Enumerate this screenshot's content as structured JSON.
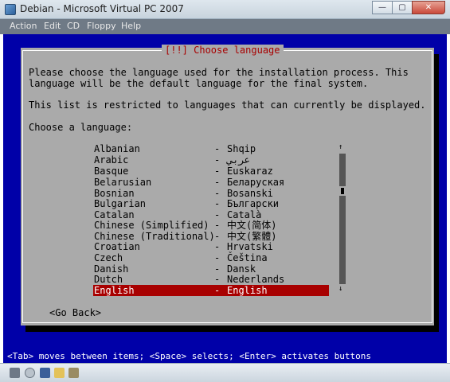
{
  "window": {
    "title": "Debian - Microsoft Virtual PC 2007",
    "min_glyph": "—",
    "restore_glyph": "▢",
    "close_glyph": "✕"
  },
  "menu": {
    "items": [
      "Action",
      "Edit",
      "CD",
      "Floppy",
      "Help"
    ]
  },
  "dialog": {
    "title": "[!!] Choose language",
    "intro_line1": "Please choose the language used for the installation process. This",
    "intro_line2": "language will be the default language for the final system.",
    "restriction": "This list is restricted to languages that can currently be displayed.",
    "prompt": "Choose a language:",
    "languages": [
      {
        "name": "Albanian",
        "native": "Shqip"
      },
      {
        "name": "Arabic",
        "native": "عربي"
      },
      {
        "name": "Basque",
        "native": "Euskaraz"
      },
      {
        "name": "Belarusian",
        "native": "Беларуская"
      },
      {
        "name": "Bosnian",
        "native": "Bosanski"
      },
      {
        "name": "Bulgarian",
        "native": "Български"
      },
      {
        "name": "Catalan",
        "native": "Català"
      },
      {
        "name": "Chinese (Simplified)",
        "native": "中文(简体)"
      },
      {
        "name": "Chinese (Traditional)",
        "native": "中文(繁體)"
      },
      {
        "name": "Croatian",
        "native": "Hrvatski"
      },
      {
        "name": "Czech",
        "native": "Čeština"
      },
      {
        "name": "Danish",
        "native": "Dansk"
      },
      {
        "name": "Dutch",
        "native": "Nederlands"
      },
      {
        "name": "English",
        "native": "English",
        "selected": true
      }
    ],
    "separator": "-",
    "go_back": "<Go Back>",
    "scroll_up": "↑",
    "scroll_down": "↓"
  },
  "status_bar": "<Tab> moves between items; <Space> selects; <Enter> activates buttons",
  "colors": {
    "console_bg": "#0000a8",
    "dialog_bg": "#aaaaaa",
    "selection": "#a80000"
  }
}
